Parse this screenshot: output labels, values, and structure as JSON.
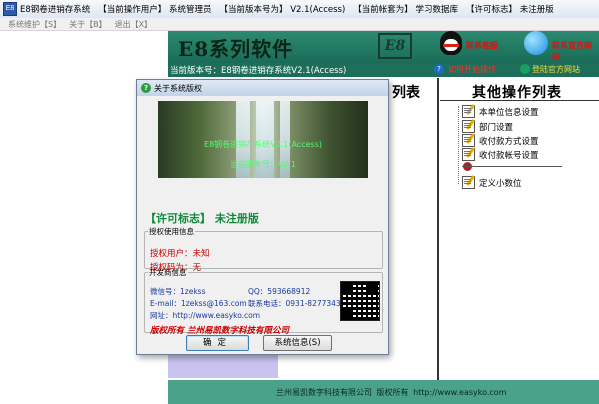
{
  "window": {
    "title_parts": [
      "E8钢卷进销存系统",
      "【当前操作用户】 系统管理员",
      "【当前版本号为】 V2.1(Access)",
      "【当前帐套为】 学习数据库",
      "【许可标志】 未注册版"
    ]
  },
  "menu": {
    "items": [
      "系统维护【S】",
      "关于【B】",
      "退出【X】"
    ]
  },
  "header": {
    "brand_title": "E8系列软件",
    "logo_text": "E8",
    "qq_label": "联系客服",
    "globe_label": "联系官方网站",
    "version_text": "当前版本号：E8钢卷进销存系统V2.1(Access)",
    "howto_label": "如何开始操作",
    "login_label": "登陆官方网站"
  },
  "main": {
    "mid_list_title": "列表",
    "right_title": "其他操作列表",
    "right_items": [
      "本单位信息设置",
      "部门设置",
      "收付款方式设置",
      "收付款帐号设置",
      "定义小数位"
    ]
  },
  "footer": {
    "text": "兰州易凯数字科技有限公司    版权所有    http://www.easyko.com"
  },
  "dialog": {
    "title": "关于系统版权",
    "image_caption": "E8钢卷进销存系统V2.1(Access)",
    "image_caption2": "当前版本号：V2.1",
    "license_line": "【许可标志】 未注册版",
    "auth_group": {
      "legend": "授权使用信息",
      "user": "授权用户：未知",
      "code": "授权码为：无"
    },
    "dev_group": {
      "legend": "开发商信息",
      "wechat": "微信号：1zekss",
      "qq": "QQ：593668912",
      "email": "E-mail：1zekss@163.com",
      "phone": "联系电话：0931-8277343",
      "web": "网址：http://www.easyko.com",
      "copyright": "版权所有   兰州易凯数字科技有限公司"
    },
    "ok_label": "确定",
    "sysinfo_label": "系统信息(S)"
  },
  "icons": {
    "app": "app-icon",
    "qq": "qq-penguin-icon",
    "globe": "globe-icon",
    "dialog": "info-icon",
    "qr": "qr-code"
  },
  "colors": {
    "header_green": "#1a6c58",
    "license_green": "#108a3a",
    "alert_red": "#c00000",
    "footer_green": "#4aa28a",
    "lavender": "#c9c3f0"
  }
}
